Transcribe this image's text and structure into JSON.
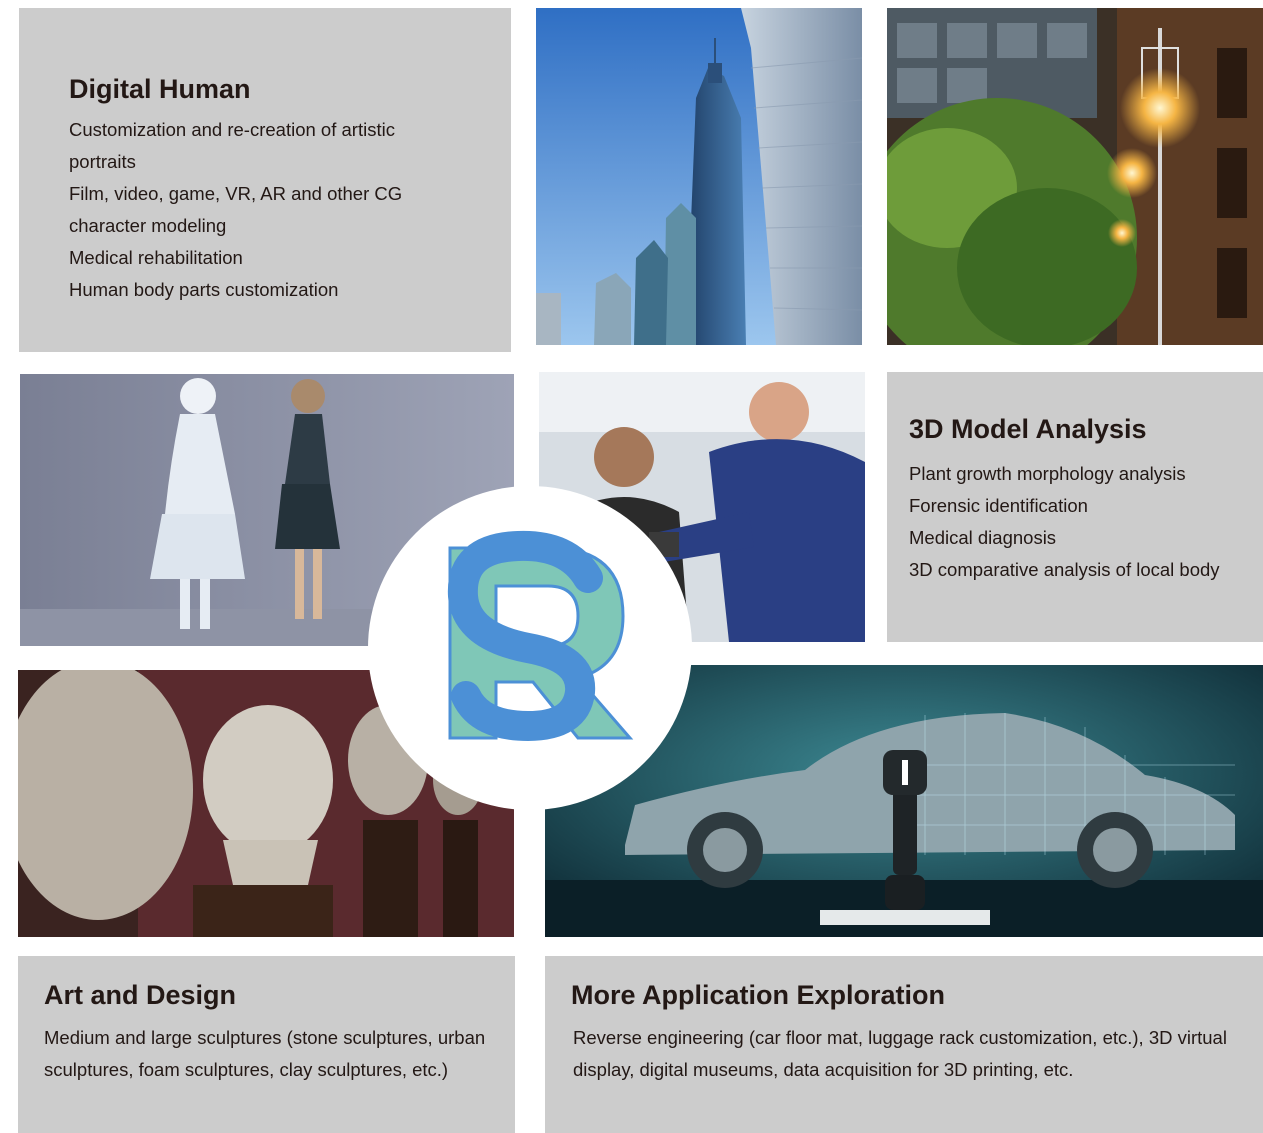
{
  "digital_human": {
    "title": "Digital Human",
    "items": [
      "Customization and re-creation of artistic portraits",
      "Film, video, game, VR, AR and other CG character modeling",
      "Medical rehabilitation",
      "Human body parts customization"
    ]
  },
  "model_analysis": {
    "title": "3D Model Analysis",
    "items": [
      "Plant growth morphology analysis",
      "Forensic identification",
      "Medical diagnosis",
      "3D comparative analysis of local body"
    ]
  },
  "art_design": {
    "title": "Art and Design",
    "description": "Medium and large sculptures (stone sculptures, urban sculptures, foam sculptures, clay sculptures, etc.)"
  },
  "more_exploration": {
    "title": "More Application Exploration",
    "description": "Reverse engineering (car floor mat, luggage rack customization, etc.), 3D virtual display, digital museums, data acquisition for 3D printing, etc."
  },
  "colors": {
    "tile_background": "#cccccc",
    "heading_text": "#231815",
    "logo_teal": "#7fc7b7",
    "logo_blue": "#4c90d6"
  },
  "icons": {
    "logo": "rs-logo-icon"
  }
}
